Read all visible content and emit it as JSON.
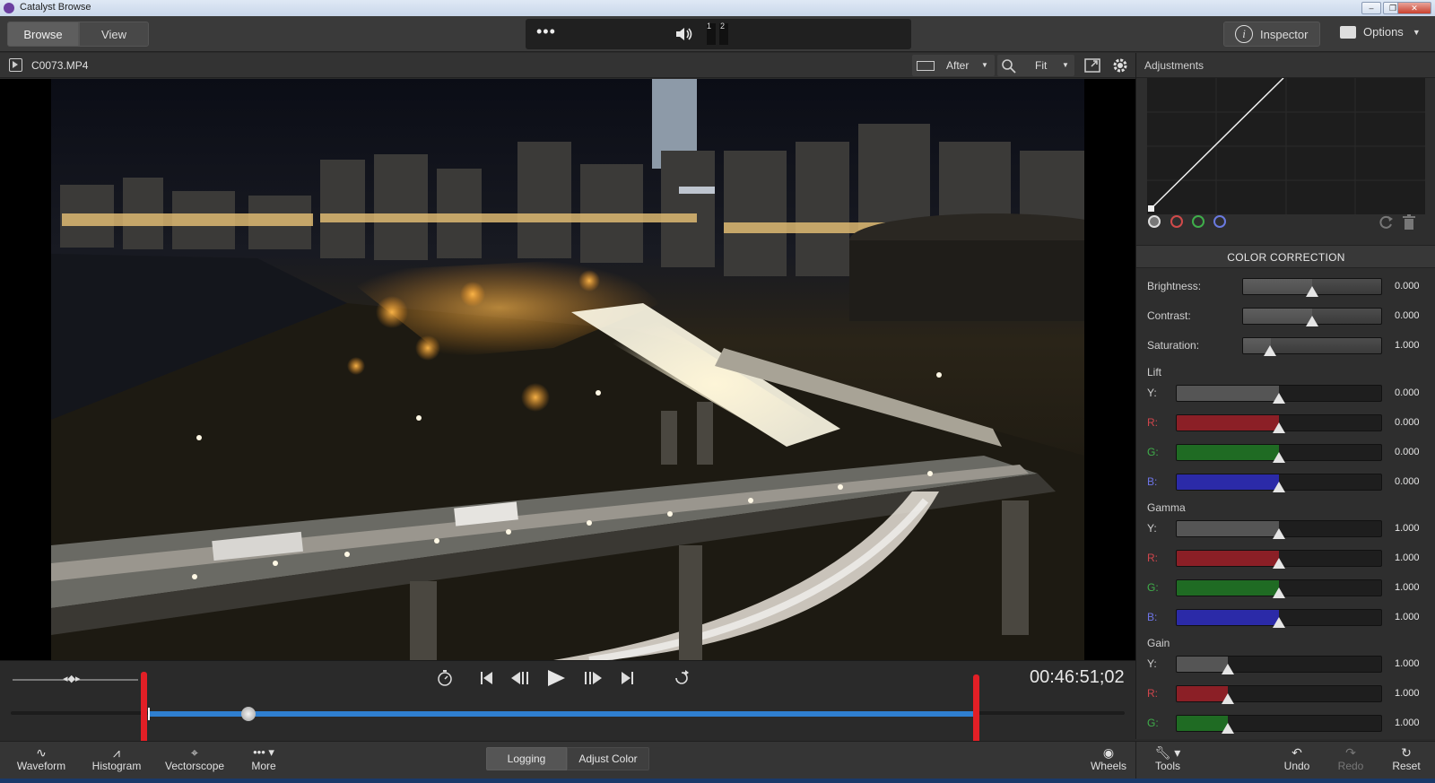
{
  "window": {
    "title": "Catalyst Browse"
  },
  "toolbar": {
    "browse_label": "Browse",
    "view_label": "View",
    "audio_channel_1": "1",
    "audio_channel_2": "2",
    "inspector_label": "Inspector",
    "options_label": "Options"
  },
  "viewer_bar": {
    "clip_name": "C0073.MP4",
    "compare_mode": "After",
    "zoom_mode": "Fit"
  },
  "panel": {
    "title": "Adjustments",
    "section_title": "COLOR CORRECTION",
    "basic": [
      {
        "label": "Brightness:",
        "value": "0.000",
        "level": 0.5
      },
      {
        "label": "Contrast:",
        "value": "0.000",
        "level": 0.5
      },
      {
        "label": "Saturation:",
        "value": "1.000",
        "level": 0.2
      }
    ],
    "lift_title": "Lift",
    "gamma_title": "Gamma",
    "gain_title": "Gain",
    "lift": [
      {
        "label": "Y:",
        "value": "0.000",
        "color": "#555555",
        "level": 0.5
      },
      {
        "label": "R:",
        "value": "0.000",
        "color": "#8b1f26",
        "level": 0.5
      },
      {
        "label": "G:",
        "value": "0.000",
        "color": "#1f6b23",
        "level": 0.5
      },
      {
        "label": "B:",
        "value": "0.000",
        "color": "#2b2aa8",
        "level": 0.5
      }
    ],
    "gamma": [
      {
        "label": "Y:",
        "value": "1.000",
        "color": "#555555",
        "level": 0.5
      },
      {
        "label": "R:",
        "value": "1.000",
        "color": "#8b1f26",
        "level": 0.5
      },
      {
        "label": "G:",
        "value": "1.000",
        "color": "#1f6b23",
        "level": 0.5
      },
      {
        "label": "B:",
        "value": "1.000",
        "color": "#2b2aa8",
        "level": 0.5
      }
    ],
    "gain": [
      {
        "label": "Y:",
        "value": "1.000",
        "color": "#555555",
        "level": 0.25
      },
      {
        "label": "R:",
        "value": "1.000",
        "color": "#8b1f26",
        "level": 0.25
      },
      {
        "label": "G:",
        "value": "1.000",
        "color": "#1f6b23",
        "level": 0.25
      }
    ]
  },
  "playback": {
    "timecode": "00:46:51;02",
    "playhead_fraction": 0.207
  },
  "bottom": {
    "waveform_label": "Waveform",
    "histogram_label": "Histogram",
    "vectorscope_label": "Vectorscope",
    "more_label": "More",
    "logging_label": "Logging",
    "adjust_color_label": "Adjust Color",
    "wheels_label": "Wheels",
    "tools_label": "Tools",
    "undo_label": "Undo",
    "redo_label": "Redo",
    "reset_label": "Reset"
  },
  "colors": {
    "accent_blue": "#2f7fd0",
    "marker_red": "#e21f26"
  }
}
